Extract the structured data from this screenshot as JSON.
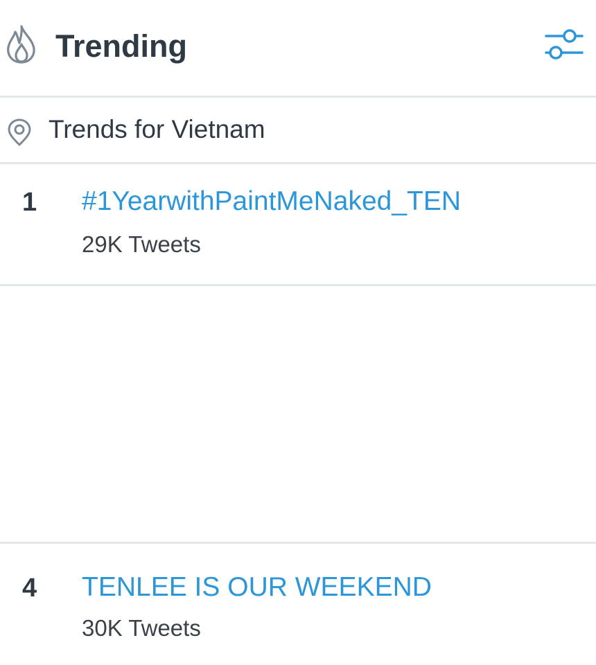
{
  "header": {
    "title": "Trending",
    "icon": "flame-icon",
    "settings_icon": "settings-sliders-icon",
    "accent_color": "#2b96d8"
  },
  "location": {
    "icon": "location-pin-icon",
    "label": "Trends for Vietnam"
  },
  "trends": [
    {
      "rank": "1",
      "name": "#1YearwithPaintMeNaked_TEN",
      "count": "29K Tweets"
    },
    {
      "rank": "4",
      "name": "TENLEE IS OUR WEEKEND",
      "count": "30K Tweets"
    }
  ]
}
